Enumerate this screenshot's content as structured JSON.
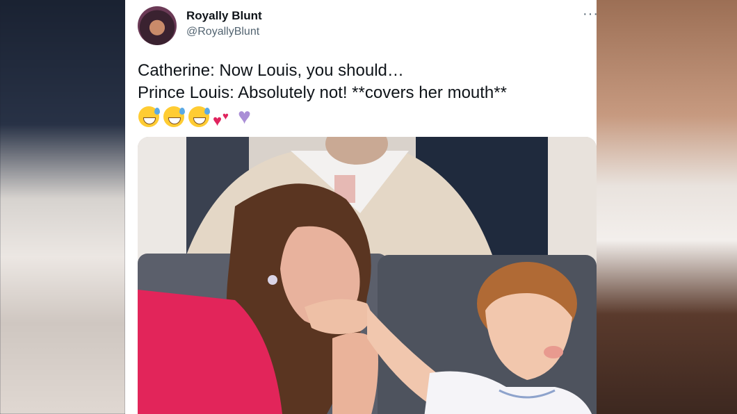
{
  "tweet": {
    "author": {
      "display_name": "Royally Blunt",
      "handle": "@RoyallyBlunt"
    },
    "more_label": "···",
    "text_lines": [
      "Catherine: Now Louis, you should…",
      "Prince Louis: Absolutely not! **covers her mouth**"
    ],
    "emojis": [
      "sweat-smile",
      "sweat-smile",
      "sweat-smile",
      "two-hearts",
      "purple-heart"
    ],
    "media": {
      "type": "photo"
    }
  },
  "colors": {
    "text_primary": "#0f1419",
    "text_secondary": "#536471",
    "dress_pink": "#e2255a"
  }
}
